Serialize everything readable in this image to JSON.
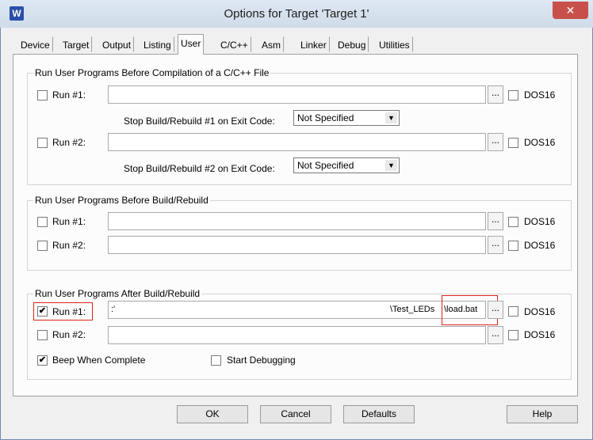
{
  "window": {
    "title": "Options for Target 'Target 1'",
    "app_icon": "W",
    "close_glyph": "✕"
  },
  "tabs": [
    "Device",
    "Target",
    "Output",
    "Listing",
    "User",
    "C/C++",
    "Asm",
    "Linker",
    "Debug",
    "Utilities"
  ],
  "active_tab": "User",
  "groups": {
    "before_compile": {
      "title": "Run User Programs Before Compilation of a C/C++ File",
      "run1": {
        "label": "Run #1:",
        "checked": false,
        "value": "",
        "dos16": "DOS16"
      },
      "stop1": {
        "label": "Stop Build/Rebuild #1 on Exit Code:",
        "value": "Not Specified"
      },
      "run2": {
        "label": "Run #2:",
        "checked": false,
        "value": "",
        "dos16": "DOS16"
      },
      "stop2": {
        "label": "Stop Build/Rebuild #2 on Exit Code:",
        "value": "Not Specified"
      }
    },
    "before_build": {
      "title": "Run User Programs Before Build/Rebuild",
      "run1": {
        "label": "Run #1:",
        "checked": false,
        "value": "",
        "dos16": "DOS16"
      },
      "run2": {
        "label": "Run #2:",
        "checked": false,
        "value": "",
        "dos16": "DOS16"
      }
    },
    "after_build": {
      "title": "Run User Programs After Build/Rebuild",
      "run1": {
        "label": "Run #1:",
        "checked": true,
        "value_prefix": ":'",
        "value_mid": "\\Test_LEDs",
        "value_end": "\\load.bat",
        "dos16": "DOS16"
      },
      "run2": {
        "label": "Run #2:",
        "checked": false,
        "value": "",
        "dos16": "DOS16"
      },
      "beep": {
        "label": "Beep When Complete",
        "checked": true
      },
      "debug": {
        "label": "Start Debugging",
        "checked": false
      }
    }
  },
  "browse_label": "...",
  "checkmark": "✔",
  "combo_arrow": "▼",
  "buttons": {
    "ok": "OK",
    "cancel": "Cancel",
    "defaults": "Defaults",
    "help": "Help"
  }
}
